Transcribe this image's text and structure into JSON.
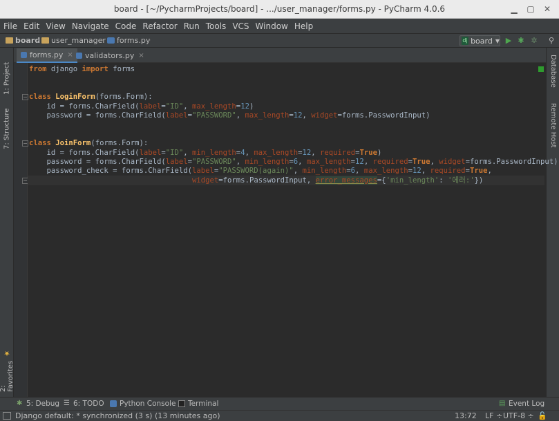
{
  "window": {
    "title": "board - [~/PycharmProjects/board] - .../user_manager/forms.py - PyCharm 4.0.6"
  },
  "menu": [
    "File",
    "Edit",
    "View",
    "Navigate",
    "Code",
    "Refactor",
    "Run",
    "Tools",
    "VCS",
    "Window",
    "Help"
  ],
  "breadcrumbs": [
    "board",
    "user_manager",
    "forms.py"
  ],
  "run_config": "board",
  "tabs": [
    {
      "label": "forms.py",
      "active": true
    },
    {
      "label": "validators.py",
      "active": false
    }
  ],
  "left_tools": [
    "1: Project",
    "7: Structure",
    "2: Favorites"
  ],
  "right_tools": [
    "Database",
    "Remote Host"
  ],
  "code_lines": {
    "l1": "from django import forms",
    "l4a": "class",
    "l4b": "LoginForm",
    "l4c": "(forms.Form):",
    "l5": "    id = forms.CharField(",
    "l6": "    password = forms.CharField(",
    "l9a": "class",
    "l9b": "JoinForm",
    "l9c": "(forms.Form):"
  },
  "code_tokens": {
    "from": "from",
    "django": " django ",
    "import": "import",
    "forms": " forms",
    "label": "label",
    "id_str": "\"ID\"",
    "pw_str": "\"PASSWORD\"",
    "pwa_str": "\"PASSWORD(again)\"",
    "max_length": "max_length",
    "min_length": "min_length",
    "required": "required",
    "widget": "widget",
    "true": "True",
    "n12": "12",
    "n4": "4",
    "n6": "6",
    "pwinput": "forms.PasswordInput",
    "error_messages": "error_messages",
    "ml_key": "'min_length'",
    "err_val": "'에러:'"
  },
  "bottom_tools": [
    "5: Debug",
    "6: TODO",
    "Python Console",
    "Terminal",
    "Event Log"
  ],
  "status": {
    "message": "Django default: * synchronized (3 s) (13 minutes ago)",
    "position": "13:72",
    "line_sep": "LF ÷",
    "encoding": "UTF-8 ÷"
  },
  "colors": {
    "keyword": "#cc7832",
    "string": "#6a8759",
    "number": "#6897bb",
    "param": "#aa4926",
    "text": "#a9b7c6"
  }
}
